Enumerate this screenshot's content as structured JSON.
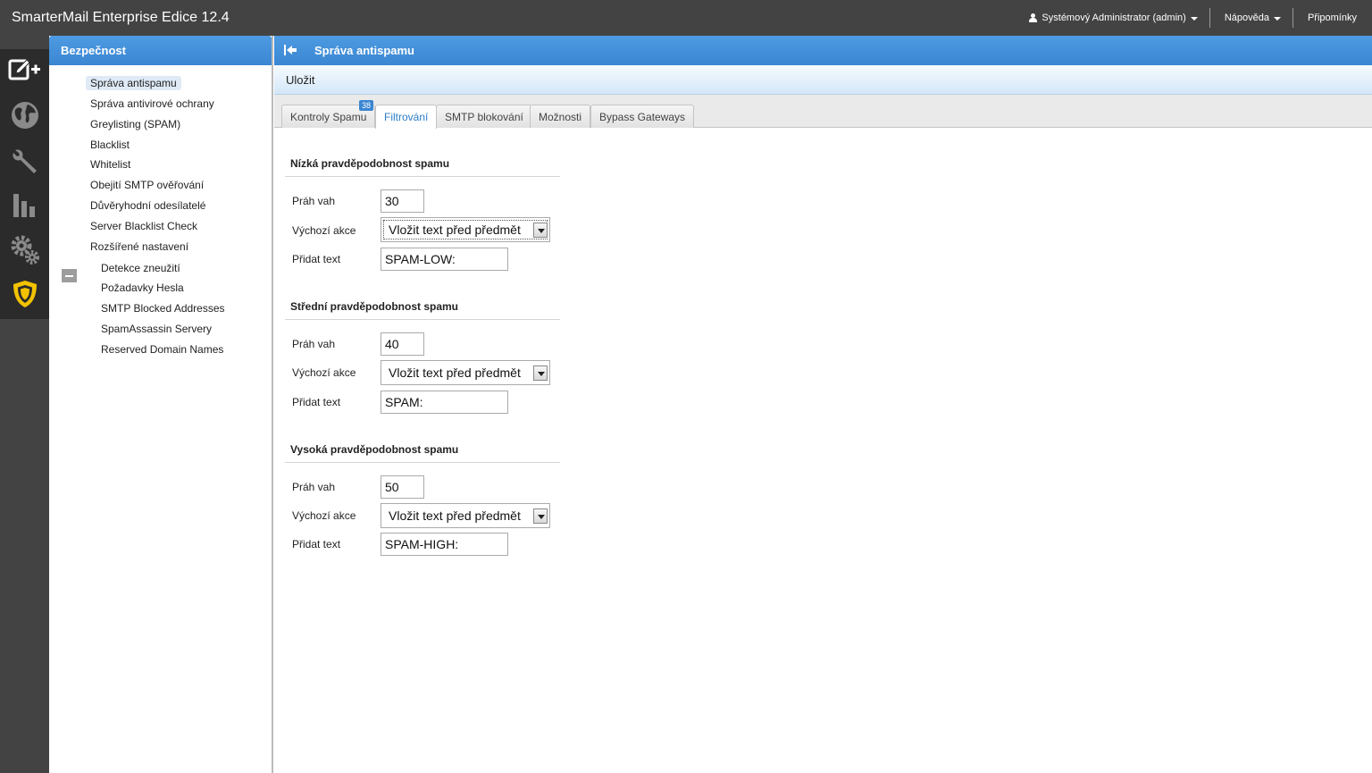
{
  "app": {
    "title": "SmarterMail Enterprise Edice 12.4"
  },
  "topnav": {
    "user": "Systémový Administrator (admin)",
    "help": "Nápověda",
    "reminders": "Připomínky"
  },
  "rail": {
    "icons": [
      "compose-plus-icon",
      "globe-icon",
      "wrench-icon",
      "bar-chart-icon",
      "gears-icon",
      "shield-icon"
    ],
    "active_color": "#f2c200"
  },
  "sidebar": {
    "title": "Bezpečnost",
    "items": [
      {
        "label": "Správa antispamu"
      },
      {
        "label": "Správa antivirové ochrany"
      },
      {
        "label": "Greylisting (SPAM)"
      },
      {
        "label": "Blacklist"
      },
      {
        "label": "Whitelist"
      },
      {
        "label": "Obejití SMTP ověřování"
      },
      {
        "label": "Důvěryhodní odesílatelé"
      },
      {
        "label": "Server Blacklist Check"
      },
      {
        "label": "Rozšířené nastavení"
      }
    ],
    "subitems": [
      {
        "label": "Detekce zneužití"
      },
      {
        "label": "Požadavky Hesla"
      },
      {
        "label": "SMTP Blocked Addresses"
      },
      {
        "label": "SpamAssassin Servery"
      },
      {
        "label": "Reserved Domain Names"
      }
    ]
  },
  "main": {
    "title": "Správa antispamu",
    "save": "Uložit",
    "tabs": [
      {
        "label": "Kontroly Spamu",
        "badge": "38"
      },
      {
        "label": "Filtrování"
      },
      {
        "label": "SMTP blokování"
      },
      {
        "label": "Možnosti"
      },
      {
        "label": "Bypass Gateways"
      }
    ],
    "labels": {
      "threshold": "Práh vah",
      "action": "Výchozí akce",
      "text": "Přidat text"
    },
    "sections": [
      {
        "title": "Nízká pravděpodobnost spamu",
        "threshold": "30",
        "action": "Vložit text před předmět",
        "text": "SPAM-LOW:"
      },
      {
        "title": "Střední pravděpodobnost spamu",
        "threshold": "40",
        "action": "Vložit text před předmět",
        "text": "SPAM:"
      },
      {
        "title": "Vysoká pravděpodobnost spamu",
        "threshold": "50",
        "action": "Vložit text před předmět",
        "text": "SPAM-HIGH:"
      }
    ]
  },
  "colors": {
    "header_blue": "#3b86d2",
    "topbar": "#434343",
    "accent_link": "#2c7dc6"
  }
}
